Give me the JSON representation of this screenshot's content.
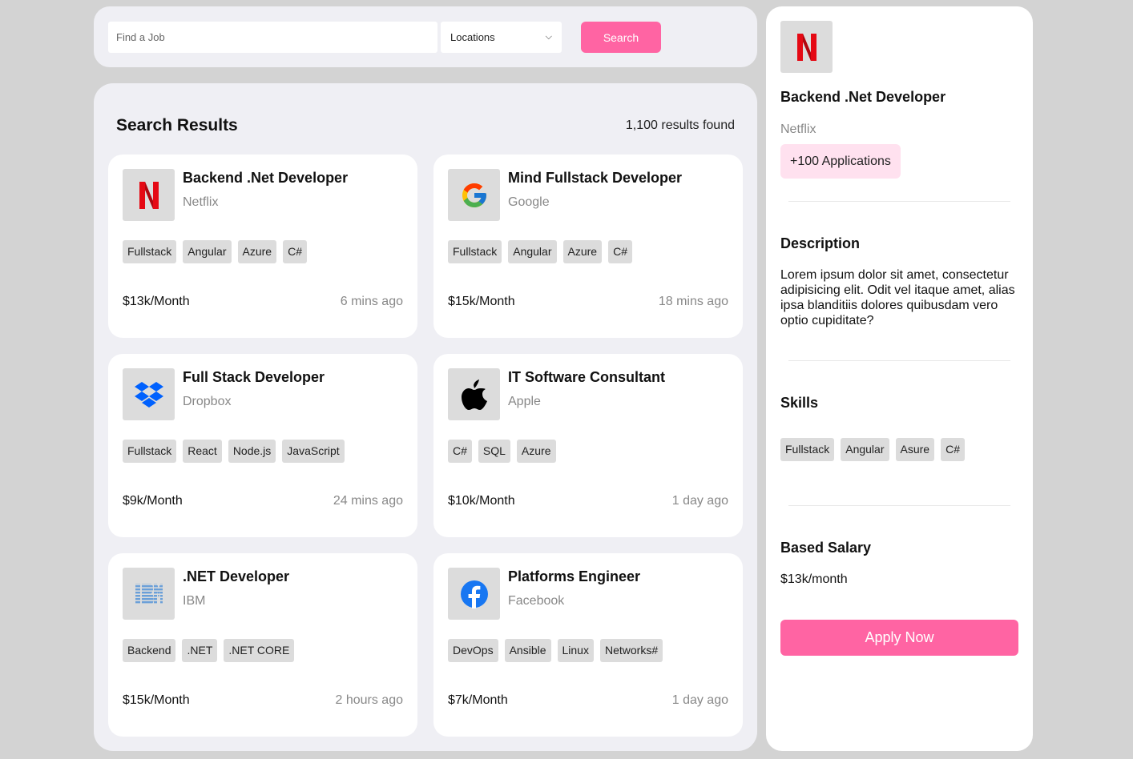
{
  "search": {
    "placeholder": "Find a Job",
    "location_selected": "Locations",
    "button_label": "Search"
  },
  "results": {
    "title": "Search Results",
    "count_text": "1,100 results found",
    "jobs": [
      {
        "title": "Backend .Net Developer",
        "company": "Netflix",
        "logo": "netflix-logo",
        "tags": [
          "Fullstack",
          "Angular",
          "Azure",
          "C#"
        ],
        "salary": "$13k/Month",
        "posted": "6 mins ago"
      },
      {
        "title": "Mind Fullstack Developer",
        "company": "Google",
        "logo": "google-logo",
        "tags": [
          "Fullstack",
          "Angular",
          "Azure",
          "C#"
        ],
        "salary": "$15k/Month",
        "posted": "18 mins ago"
      },
      {
        "title": "Full Stack Developer",
        "company": "Dropbox",
        "logo": "dropbox-logo",
        "tags": [
          "Fullstack",
          "React",
          "Node.js",
          "JavaScript"
        ],
        "salary": "$9k/Month",
        "posted": "24 mins ago"
      },
      {
        "title": "IT Software Consultant",
        "company": "Apple",
        "logo": "apple-logo",
        "tags": [
          "C#",
          "SQL",
          "Azure"
        ],
        "salary": "$10k/Month",
        "posted": "1 day ago"
      },
      {
        "title": ".NET Developer",
        "company": "IBM",
        "logo": "ibm-logo",
        "tags": [
          "Backend",
          ".NET",
          ".NET CORE"
        ],
        "salary": "$15k/Month",
        "posted": "2 hours ago"
      },
      {
        "title": "Platforms Engineer",
        "company": "Facebook",
        "logo": "facebook-logo",
        "tags": [
          "DevOps",
          "Ansible",
          "Linux",
          "Networks#"
        ],
        "salary": "$7k/Month",
        "posted": "1 day ago"
      }
    ]
  },
  "detail": {
    "logo": "netflix-logo",
    "title": "Backend .Net Developer",
    "company": "Netflix",
    "applications": "+100 Applications",
    "description_heading": "Description",
    "description": "Lorem ipsum dolor sit amet, consectetur adipisicing elit. Odit vel itaque amet, alias ipsa blanditiis dolores quibusdam vero optio cupiditate?",
    "skills_heading": "Skills",
    "skills": [
      "Fullstack",
      "Angular",
      "Asure",
      "C#"
    ],
    "salary_heading": "Based Salary",
    "salary": "$13k/month",
    "apply_label": "Apply Now"
  },
  "colors": {
    "accent": "#ff64a3",
    "accent_light": "#ffe1ef",
    "page_bg": "#d3d3d3",
    "panel_bg": "#efeff4"
  }
}
